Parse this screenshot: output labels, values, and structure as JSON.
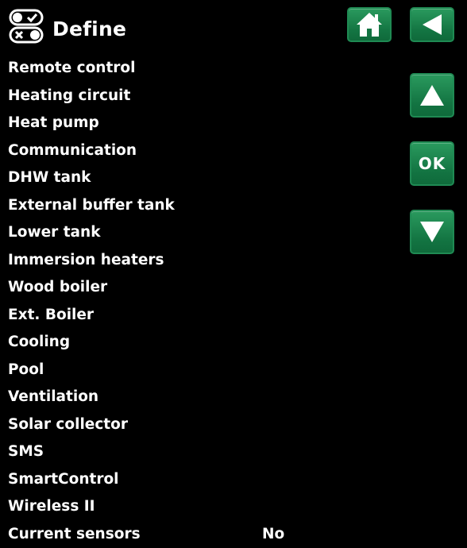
{
  "header": {
    "title": "Define",
    "icon": "define-toggle-icon"
  },
  "nav": {
    "home_icon": "home-icon",
    "back_icon": "back-arrow-icon",
    "up_icon": "up-arrow-icon",
    "ok_label": "OK",
    "down_icon": "down-arrow-icon"
  },
  "colors": {
    "background": "#000000",
    "text": "#ffffff",
    "button": "#137442"
  },
  "menu": {
    "items": [
      {
        "label": "Remote control",
        "value": ""
      },
      {
        "label": "Heating circuit",
        "value": ""
      },
      {
        "label": "Heat pump",
        "value": ""
      },
      {
        "label": "Communication",
        "value": ""
      },
      {
        "label": "DHW tank",
        "value": ""
      },
      {
        "label": "External buffer tank",
        "value": ""
      },
      {
        "label": "Lower tank",
        "value": ""
      },
      {
        "label": "Immersion heaters",
        "value": ""
      },
      {
        "label": "Wood boiler",
        "value": ""
      },
      {
        "label": "Ext. Boiler",
        "value": ""
      },
      {
        "label": "Cooling",
        "value": ""
      },
      {
        "label": "Pool",
        "value": ""
      },
      {
        "label": "Ventilation",
        "value": ""
      },
      {
        "label": "Solar collector",
        "value": ""
      },
      {
        "label": "SMS",
        "value": ""
      },
      {
        "label": "SmartControl",
        "value": ""
      },
      {
        "label": "Wireless II",
        "value": ""
      },
      {
        "label": "Current sensors",
        "value": "No"
      }
    ]
  }
}
